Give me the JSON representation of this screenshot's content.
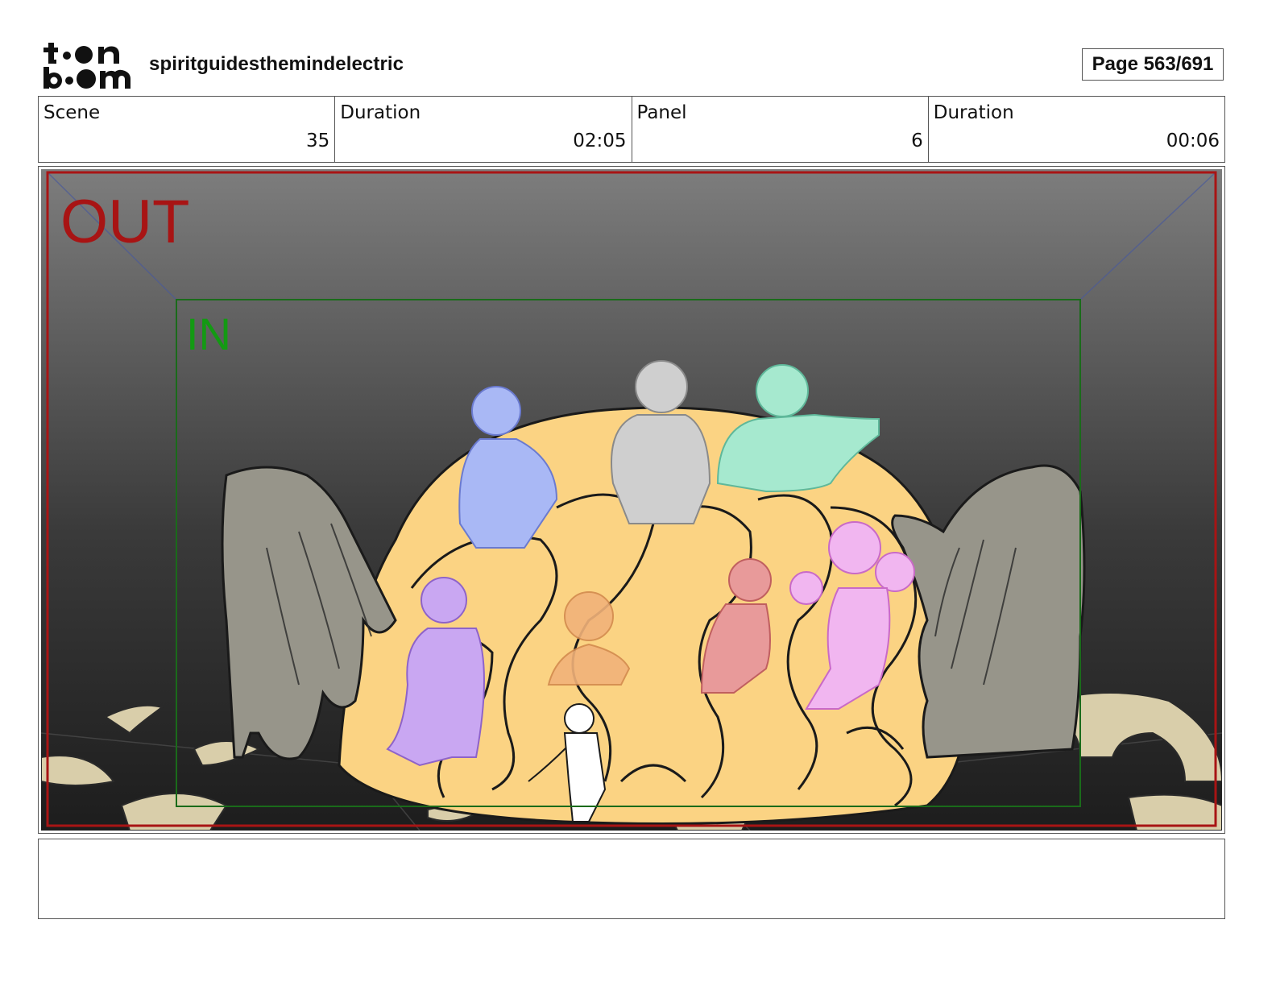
{
  "header": {
    "logo_text": "toon boom",
    "project_title": "spiritguidesthemindelectric",
    "page_label": "Page 563/691"
  },
  "info": {
    "scene_label": "Scene",
    "scene_value": "35",
    "scene_duration_label": "Duration",
    "scene_duration_value": "02:05",
    "panel_label": "Panel",
    "panel_value": "6",
    "panel_duration_label": "Duration",
    "panel_duration_value": "00:06"
  },
  "panel": {
    "out_label": "OUT",
    "in_label": "IN",
    "colors": {
      "out_frame": "#a81414",
      "in_frame": "#1a6b1a",
      "brain": "#fbd383",
      "hands": "#97958a",
      "ground_blobs": "#d9ceaa"
    },
    "characters": [
      {
        "name": "blue spirit",
        "color": "#a9b8f5"
      },
      {
        "name": "grey spirit",
        "color": "#cfcfcf"
      },
      {
        "name": "mint spirit",
        "color": "#a6e9cf"
      },
      {
        "name": "purple spirit",
        "color": "#c9a7f2"
      },
      {
        "name": "orange spirit",
        "color": "#f2b27a"
      },
      {
        "name": "red spirit",
        "color": "#e89a9a"
      },
      {
        "name": "pink spirit",
        "color": "#f1b6f0"
      }
    ]
  },
  "notes": {
    "text": ""
  }
}
